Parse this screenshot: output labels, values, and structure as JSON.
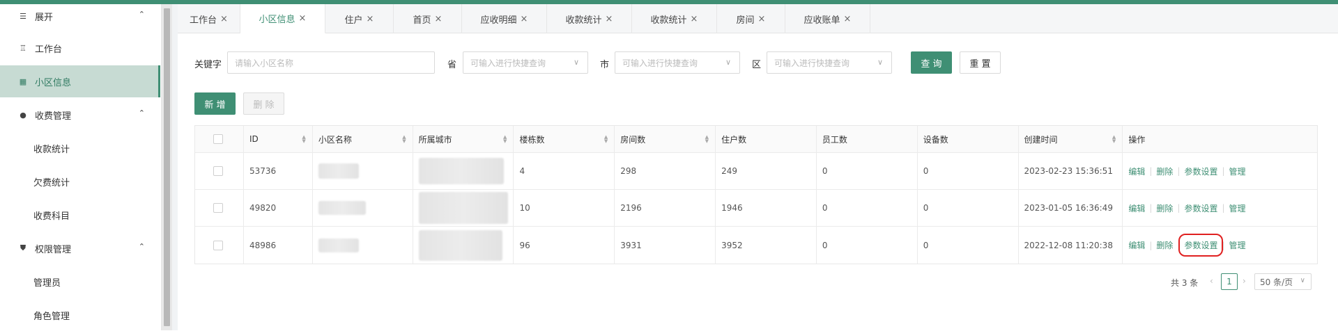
{
  "sidebar": {
    "expand_label": "展开",
    "items": [
      {
        "label": "工作台",
        "icon": "workbench-icon"
      },
      {
        "label": "小区信息",
        "icon": "building-icon"
      },
      {
        "label": "收费管理",
        "icon": "fee-icon"
      },
      {
        "label": "收款统计"
      },
      {
        "label": "欠费统计"
      },
      {
        "label": "收费科目"
      },
      {
        "label": "权限管理",
        "icon": "shield-icon"
      },
      {
        "label": "管理员"
      },
      {
        "label": "角色管理"
      }
    ]
  },
  "tabs": [
    {
      "label": "工作台"
    },
    {
      "label": "小区信息"
    },
    {
      "label": "住户"
    },
    {
      "label": "首页"
    },
    {
      "label": "应收明细"
    },
    {
      "label": "收款统计"
    },
    {
      "label": "收款统计"
    },
    {
      "label": "房间"
    },
    {
      "label": "应收账单"
    }
  ],
  "search": {
    "keyword_label": "关键字",
    "keyword_placeholder": "请输入小区名称",
    "province_label": "省",
    "city_label": "市",
    "district_label": "区",
    "select_placeholder": "可输入进行快捷查询",
    "query_button": "查 询",
    "reset_button": "重 置"
  },
  "actions": {
    "add_button": "新 增",
    "delete_button": "删 除"
  },
  "table": {
    "headers": [
      "ID",
      "小区名称",
      "所属城市",
      "楼栋数",
      "房间数",
      "住户数",
      "员工数",
      "设备数",
      "创建时间",
      "操作"
    ],
    "rows": [
      {
        "id": "53736",
        "buildings": "4",
        "rooms": "298",
        "residents": "249",
        "staff": "0",
        "devices": "0",
        "created": "2023-02-23 15:36:51"
      },
      {
        "id": "49820",
        "buildings": "10",
        "rooms": "2196",
        "residents": "1946",
        "staff": "0",
        "devices": "0",
        "created": "2023-01-05 16:36:49"
      },
      {
        "id": "48986",
        "buildings": "96",
        "rooms": "3931",
        "residents": "3952",
        "staff": "0",
        "devices": "0",
        "created": "2022-12-08 11:20:38"
      }
    ],
    "row_actions": {
      "edit": "编辑",
      "delete": "删除",
      "params": "参数设置",
      "manage": "管理"
    }
  },
  "pagination": {
    "total": "共 3 条",
    "current_page": "1",
    "page_size": "50 条/页"
  },
  "colors": {
    "accent": "#3f8f74",
    "highlight": "#e02020"
  }
}
